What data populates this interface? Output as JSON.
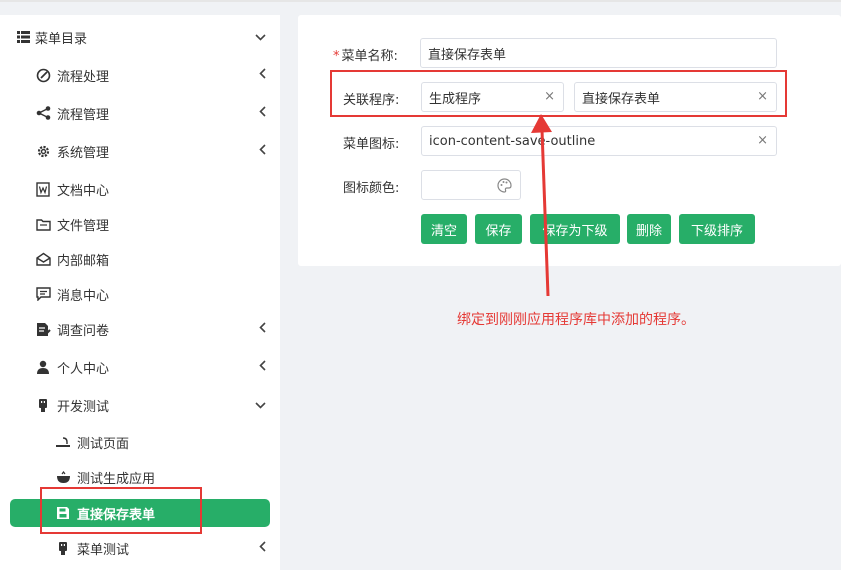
{
  "sidebar": {
    "items": [
      {
        "label": "菜单目录",
        "icon": "list-icon",
        "arrow": "⌄"
      },
      {
        "label": "流程处理",
        "icon": "edit-circle-icon",
        "arrow": "‹"
      },
      {
        "label": "流程管理",
        "icon": "share-icon",
        "arrow": "‹"
      },
      {
        "label": "系统管理",
        "icon": "gear-icon",
        "arrow": "‹"
      },
      {
        "label": "文档中心",
        "icon": "word-doc-icon",
        "arrow": ""
      },
      {
        "label": "文件管理",
        "icon": "folder-icon",
        "arrow": ""
      },
      {
        "label": "内部邮箱",
        "icon": "mail-open-icon",
        "arrow": ""
      },
      {
        "label": "消息中心",
        "icon": "message-icon",
        "arrow": ""
      },
      {
        "label": "调查问卷",
        "icon": "survey-icon",
        "arrow": "‹"
      },
      {
        "label": "个人中心",
        "icon": "user-icon",
        "arrow": "‹"
      },
      {
        "label": "开发测试",
        "icon": "usb-icon",
        "arrow": "⌄"
      },
      {
        "label": "测试页面",
        "icon": "page-icon",
        "arrow": ""
      },
      {
        "label": "测试生成应用",
        "icon": "bowl-icon",
        "arrow": ""
      },
      {
        "label": "直接保存表单",
        "icon": "save-icon",
        "arrow": ""
      },
      {
        "label": "菜单测试",
        "icon": "usb-icon",
        "arrow": "‹"
      }
    ]
  },
  "form": {
    "required_mark": "*",
    "menu_name_label": "菜单名称:",
    "menu_name_value": "直接保存表单",
    "program_label": "关联程序:",
    "program_value_1": "生成程序",
    "program_value_2": "直接保存表单",
    "icon_label": "菜单图标:",
    "icon_value": "icon-content-save-outline",
    "color_label": "图标颜色:",
    "clear_glyph": "×"
  },
  "buttons": {
    "clear": "清空",
    "save": "保存",
    "save_as_child": "保存为下级",
    "delete": "删除",
    "child_sort": "下级排序"
  },
  "annotation": {
    "text": "绑定到刚刚应用程序库中添加的程序。"
  },
  "colors": {
    "accent": "#27ae68",
    "annotation": "#e53935"
  }
}
